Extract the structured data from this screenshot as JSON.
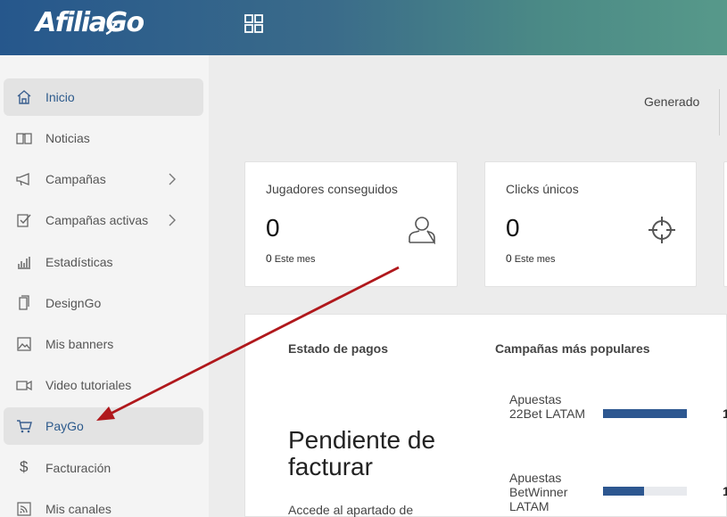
{
  "header": {
    "logo": "AfiliaGo",
    "apps_icon": "grid-icon"
  },
  "sidebar": {
    "items": [
      {
        "label": "Inicio",
        "icon": "home-icon"
      },
      {
        "label": "Noticias",
        "icon": "book-icon"
      },
      {
        "label": "Campañas",
        "icon": "megaphone-icon"
      },
      {
        "label": "Campañas activas",
        "icon": "checkbox-icon"
      },
      {
        "label": "Estadísticas",
        "icon": "bar-chart-icon"
      },
      {
        "label": "DesignGo",
        "icon": "pages-icon"
      },
      {
        "label": "Mis banners",
        "icon": "image-icon"
      },
      {
        "label": "Video tutoriales",
        "icon": "video-icon"
      },
      {
        "label": "PayGo",
        "icon": "cart-icon"
      },
      {
        "label": "Facturación",
        "icon": "dollar-icon"
      },
      {
        "label": "Mis canales",
        "icon": "rss-icon"
      }
    ]
  },
  "main": {
    "generado_label": "Generado",
    "cards": [
      {
        "title": "Jugadores conseguidos",
        "value": "0",
        "sub_value": "0",
        "sub_label": "Este mes",
        "icon": "user-icon"
      },
      {
        "title": "Clicks únicos",
        "value": "0",
        "sub_value": "0",
        "sub_label": "Este mes",
        "icon": "crosshair-icon"
      }
    ],
    "payments": {
      "title": "Estado de pagos",
      "status": "Pendiente de facturar",
      "description": "Accede al apartado de"
    },
    "popular": {
      "title": "Campañas más populares",
      "items": [
        {
          "name": "Apuestas 22Bet LATAM",
          "fill": 1.0,
          "value": "1"
        },
        {
          "name": "Apuestas BetWinner LATAM",
          "fill": 0.49,
          "value": "1"
        }
      ]
    }
  },
  "colors": {
    "accent": "#2c5a8c",
    "bar_fill": "#2d5790",
    "annotation_arrow": "#b0181c"
  }
}
